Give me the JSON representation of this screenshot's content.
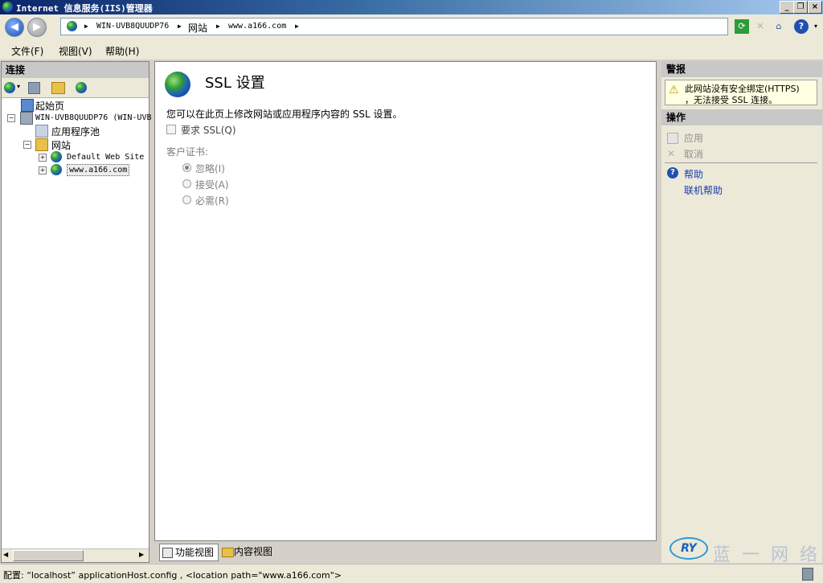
{
  "window": {
    "title": "Internet 信息服务(IIS)管理器",
    "controls": {
      "minimize": "_",
      "restore": "❐",
      "close": "×"
    }
  },
  "address": {
    "crumbs": [
      "WIN-UVB8QUUDP76",
      "网站",
      "www.a166.com"
    ],
    "separator": "▶"
  },
  "menu": {
    "items": [
      "文件(F)",
      "视图(V)",
      "帮助(H)"
    ]
  },
  "connections": {
    "title": "连接",
    "tree": {
      "start_page": "起始页",
      "server": "WIN-UVB8QUUDP76 (WIN-UVB",
      "app_pools": "应用程序池",
      "sites": "网站",
      "default_site": "Default Web Site",
      "current_site": "www.a166.com"
    }
  },
  "main": {
    "title": "SSL 设置",
    "description": "您可以在此页上修改网站或应用程序内容的 SSL 设置。",
    "require_ssl_label": "要求 SSL(Q)",
    "client_cert_label": "客户证书:",
    "options": [
      "忽略(I)",
      "接受(A)",
      "必需(R)"
    ],
    "selected_option": "忽略(I)"
  },
  "view_tabs": {
    "feature_view": "功能视图",
    "content_view": "内容视图"
  },
  "alerts": {
    "title": "警报",
    "message_line1": "此网站没有安全绑定(HTTPS)",
    "message_line2": "，无法接受 SSL 连接。"
  },
  "actions": {
    "title": "操作",
    "apply": "应用",
    "cancel": "取消",
    "help": "帮助",
    "online_help": "联机帮助"
  },
  "status": {
    "text": "配置: “localhost” applicationHost.config , <location path=\"www.a166.com\">"
  },
  "watermark": {
    "logo": "RY",
    "text": "蓝一网络"
  },
  "colors": {
    "title_bar": "#0a246a",
    "panel_header": "#c8c8c8",
    "alert_bg": "#ffffe1",
    "link_blue": "#1a3caa"
  }
}
